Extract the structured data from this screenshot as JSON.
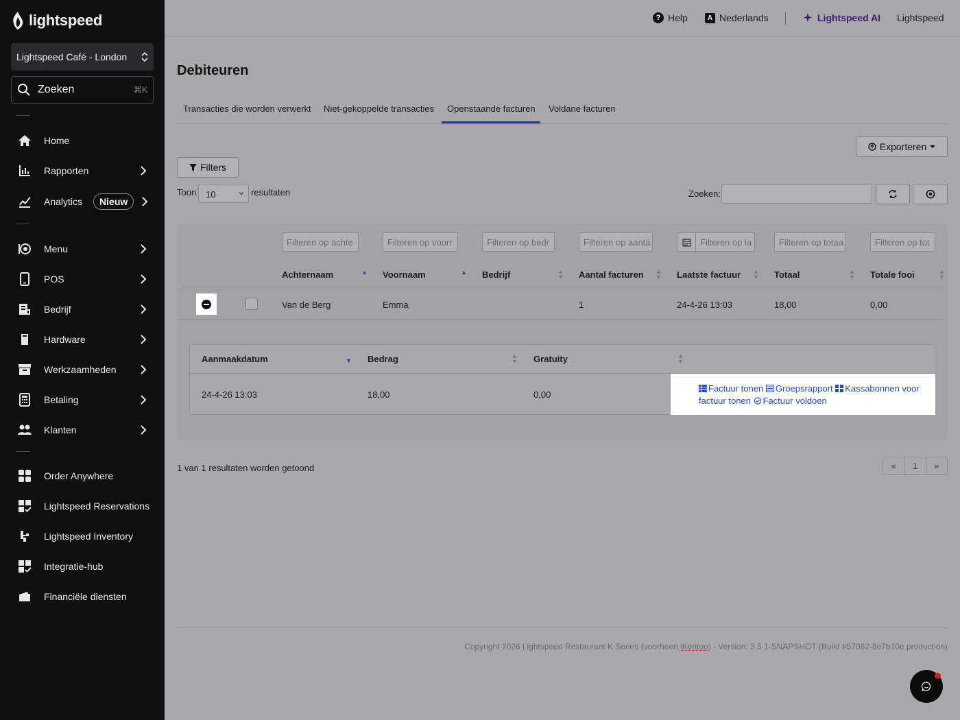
{
  "sidebar": {
    "logo": "lightspeed",
    "store": "Lightspeed Café - London",
    "search_label": "Zoeken",
    "search_shortcut": "⌘K",
    "items": [
      {
        "label": "Home",
        "icon": "home-icon"
      },
      {
        "label": "Rapporten",
        "icon": "bar-chart-icon"
      },
      {
        "label": "Analytics",
        "icon": "analytics-icon",
        "badge": "Nieuw"
      },
      {
        "label": "Menu",
        "icon": "menu-icon"
      },
      {
        "label": "POS",
        "icon": "tablet-icon"
      },
      {
        "label": "Bedrijf",
        "icon": "business-icon"
      },
      {
        "label": "Hardware",
        "icon": "hardware-icon"
      },
      {
        "label": "Werkzaamheden",
        "icon": "archive-icon"
      },
      {
        "label": "Betaling",
        "icon": "calculator-icon"
      },
      {
        "label": "Klanten",
        "icon": "users-icon"
      },
      {
        "label": "Order Anywhere",
        "icon": "order-anywhere-icon"
      },
      {
        "label": "Lightspeed Reservations",
        "icon": "reservations-icon"
      },
      {
        "label": "Lightspeed Inventory",
        "icon": "inventory-icon"
      },
      {
        "label": "Integratie-hub",
        "icon": "integration-hub-icon"
      },
      {
        "label": "Financiële diensten",
        "icon": "wallet-icon"
      }
    ]
  },
  "topbar": {
    "help": "Help",
    "language": "Nederlands",
    "ai": "Lightspeed AI",
    "account": "Lightspeed"
  },
  "page": {
    "title": "Debiteuren",
    "tabs": [
      "Transacties die worden verwerkt",
      "Niet-gekoppelde transacties",
      "Openstaande facturen",
      "Voldane facturen"
    ],
    "active_tab": "Openstaande facturen",
    "export_label": "Exporteren",
    "filters_label": "Filters",
    "show_label": "Toon",
    "page_size": "10",
    "results_label": "resultaten",
    "search_label": "Zoeken:"
  },
  "table": {
    "filter_placeholders": [
      "Filteren op achte",
      "Filteren op voorr",
      "Filteren op bedr",
      "Filteren op aantá",
      "Filteren op la",
      "Filteren op totaa",
      "Filteren op tot"
    ],
    "headers": [
      "Achternaam",
      "Voornaam",
      "Bedrijf",
      "Aantal facturen",
      "Laatste factuur",
      "Totaal",
      "Totale fooi"
    ],
    "rows": [
      {
        "achternaam": "Van de Berg",
        "voornaam": "Emma",
        "bedrijf": "",
        "aantal": "1",
        "laatste": "24-4-26 13:03",
        "totaal": "18,00",
        "fooi": "0,00"
      }
    ]
  },
  "subtable": {
    "headers": [
      "Aanmaakdatum",
      "Bedrag",
      "Gratuity"
    ],
    "rows": [
      {
        "datum": "24-4-26 13:03",
        "bedrag": "18,00",
        "gratuity": "0,00"
      }
    ],
    "actions": {
      "invoice": "Factuur tonen",
      "group_report": "Groepsrapport",
      "receipts": "Kassabonnen voor factuur tonen",
      "settle": "Factuur voldoen"
    }
  },
  "footer": {
    "result_count": "1 van 1 resultaten worden getoond",
    "pager": [
      "«",
      "1",
      "»"
    ],
    "copyright_prefix": "Copyright 2026 Lightspeed Restaurant K Series (voorheen ",
    "copyright_brand": "iKentoo",
    "copyright_suffix": ") - Version: 3.5.1-SNAPSHOT (Build #57062-8e7b10e production)"
  },
  "colors": {
    "sidebar_bg": "#0f0f10",
    "overlay_bg": "#a9a9ab",
    "link": "#1f4dcc",
    "tab_active": "#1e3a79",
    "ai_accent": "#3c1a73"
  }
}
